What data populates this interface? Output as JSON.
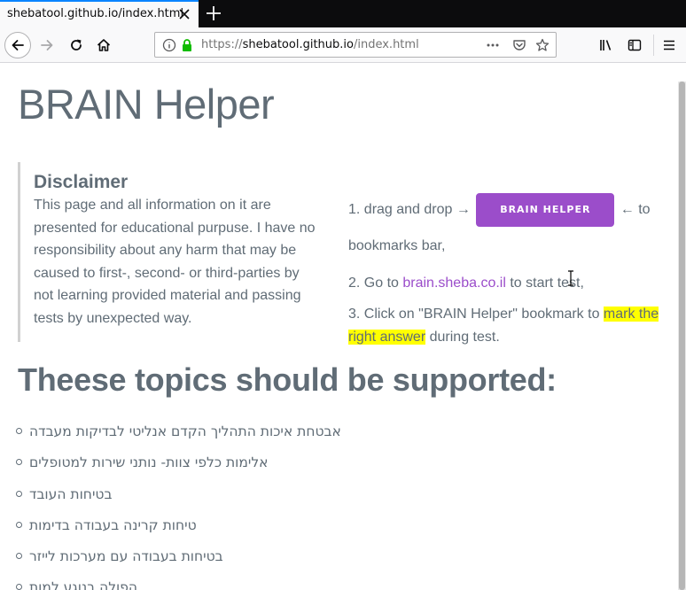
{
  "browser": {
    "tab_title": "shebatool.github.io/index.html",
    "url_scheme": "https://",
    "url_host": "shebatool.github.io",
    "url_path": "/index.html"
  },
  "page": {
    "title": "BRAIN Helper",
    "disclaimer": {
      "heading": "Disclaimer",
      "text": "This page and all information on it are presented for educational purpuse. I have no responsibility about any harm that may be caused to first-, second- or third-parties by not learning provided material and passing tests by unexpected way."
    },
    "steps": {
      "step1_prefix": "1.  drag and drop →",
      "button_label": "BRAIN HELPER",
      "step1_suffix": "← to bookmarks bar,",
      "step2_prefix": "2. Go to",
      "step2_link": "brain.sheba.co.il",
      "step2_suffix": "to start test,",
      "step3_prefix": "3.  Click on \"BRAIN Helper\" bookmark to",
      "step3_highlight": "mark the right answer",
      "step3_suffix": "during test."
    },
    "topics_title": "Theese topics should be supported:",
    "topics": [
      "אבטחת איכות התהליך הקדם אנליטי לבדיקות מעבדה",
      "אלימות כלפי צוות- נותני שירות למטופלים",
      "בטיחות העובד",
      "טיחות קרינה בעבודה בדימות",
      "בטיחות בעבודה עם מערכות לייזר",
      "הפולה בנוגע למות"
    ]
  },
  "colors": {
    "text": "#606c76",
    "accent": "#9b4dca",
    "highlight": "#ffff00",
    "firefox_blue": "#0a84ff"
  }
}
